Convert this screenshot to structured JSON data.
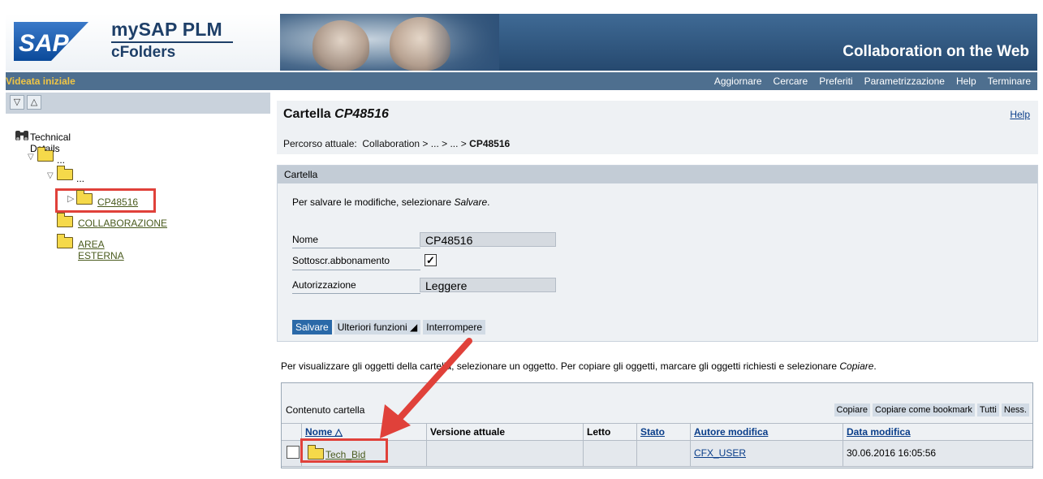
{
  "header": {
    "sap_logo_text": "SAP",
    "product_line1": "mySAP PLM",
    "product_line2": "cFolders",
    "tagline": "Collaboration on the Web"
  },
  "menubar": {
    "home": "Videata iniziale",
    "items": [
      "Aggiornare",
      "Cercare",
      "Preferiti",
      "Parametrizzazione",
      "Help",
      "Terminare"
    ]
  },
  "tree": {
    "root": "Technical Details",
    "ellipsis1": "...",
    "ellipsis2": "...",
    "selected": "CP48516",
    "children": [
      "COLLABORAZIONE",
      "AREA ESTERNA"
    ]
  },
  "main": {
    "title_prefix": "Cartella",
    "title_name": "CP48516",
    "help": "Help",
    "breadcrumb_label": "Percorso attuale:",
    "breadcrumb_path": "Collaboration > ... > ... >",
    "breadcrumb_current": "CP48516"
  },
  "form": {
    "section_title": "Cartella",
    "hint_prefix": "Per salvare le modifiche, selezionare",
    "hint_action": "Salvare",
    "hint_suffix": ".",
    "fields": {
      "name_label": "Nome",
      "name_value": "CP48516",
      "subscription_label": "Sottoscr.abbonamento",
      "subscription_checked": true,
      "auth_label": "Autorizzazione",
      "auth_value": "Leggere"
    },
    "buttons": {
      "save": "Salvare",
      "more": "Ulteriori funzioni ◢",
      "cancel": "Interrompere"
    }
  },
  "info": {
    "text": "Per visualizzare gli oggetti della cartella, selezionare un oggetto. Per copiare gli oggetti, marcare gli oggetti richiesti e selezionare",
    "action": "Copiare",
    "suffix": "."
  },
  "table": {
    "caption": "Contenuto cartella",
    "actions": [
      "Copiare",
      "Copiare come bookmark",
      "Tutti",
      "Ness."
    ],
    "columns": [
      "Nome △",
      "Versione attuale",
      "Letto",
      "Stato",
      "Autore modifica",
      "Data modifica"
    ],
    "rows": [
      {
        "name": "Tech_Bid",
        "version": "",
        "read": "",
        "status": "",
        "author": "CFX_USER",
        "date": "30.06.2016 16:05:56"
      }
    ]
  },
  "colors": {
    "banner": "#2f5279",
    "menubar": "#4e6f8f",
    "highlight": "#e0413a",
    "save_button": "#2a69a8"
  }
}
